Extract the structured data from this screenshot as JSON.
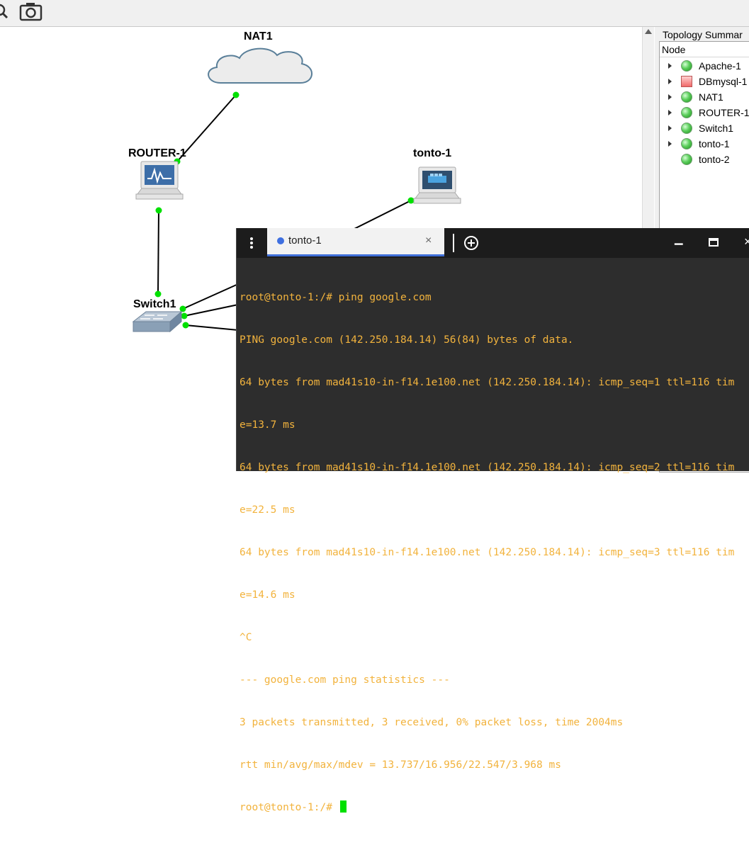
{
  "toolbar": {
    "icons": [
      "zoom-icon",
      "screenshot-icon"
    ]
  },
  "topology": {
    "nodes": [
      {
        "id": "nat1",
        "label": "NAT1",
        "type": "cloud"
      },
      {
        "id": "router1",
        "label": "ROUTER-1",
        "type": "router"
      },
      {
        "id": "tonto1",
        "label": "tonto-1",
        "type": "docker-host"
      },
      {
        "id": "switch1",
        "label": "Switch1",
        "type": "switch"
      }
    ],
    "link_color": "#000000",
    "port_color": "#00e000"
  },
  "summary_panel": {
    "title": "Topology Summar",
    "column_header": "Node",
    "items": [
      {
        "label": "Apache-1",
        "status": "green",
        "expandable": true
      },
      {
        "label": "DBmysql-1",
        "status": "red",
        "expandable": true
      },
      {
        "label": "NAT1",
        "status": "green",
        "expandable": true
      },
      {
        "label": "ROUTER-1",
        "status": "green",
        "expandable": true
      },
      {
        "label": "Switch1",
        "status": "green",
        "expandable": true
      },
      {
        "label": "tonto-1",
        "status": "green",
        "expandable": true
      },
      {
        "label": "tonto-2",
        "status": "green",
        "expandable": false
      }
    ]
  },
  "terminal": {
    "tab_title": "tonto-1",
    "close_glyph": "×",
    "minimize_glyph": "▁",
    "maximize_glyph": "🗖",
    "window_close_glyph": "×",
    "text_color": "#f2b33d",
    "lines": [
      "root@tonto-1:/# ping google.com",
      "PING google.com (142.250.184.14) 56(84) bytes of data.",
      "64 bytes from mad41s10-in-f14.1e100.net (142.250.184.14): icmp_seq=1 ttl=116 tim",
      "e=13.7 ms",
      "64 bytes from mad41s10-in-f14.1e100.net (142.250.184.14): icmp_seq=2 ttl=116 tim",
      "e=22.5 ms",
      "64 bytes from mad41s10-in-f14.1e100.net (142.250.184.14): icmp_seq=3 ttl=116 tim",
      "e=14.6 ms",
      "^C",
      "--- google.com ping statistics ---",
      "3 packets transmitted, 3 received, 0% packet loss, time 2004ms",
      "rtt min/avg/max/mdev = 13.737/16.956/22.547/3.968 ms",
      "root@tonto-1:/# "
    ]
  }
}
